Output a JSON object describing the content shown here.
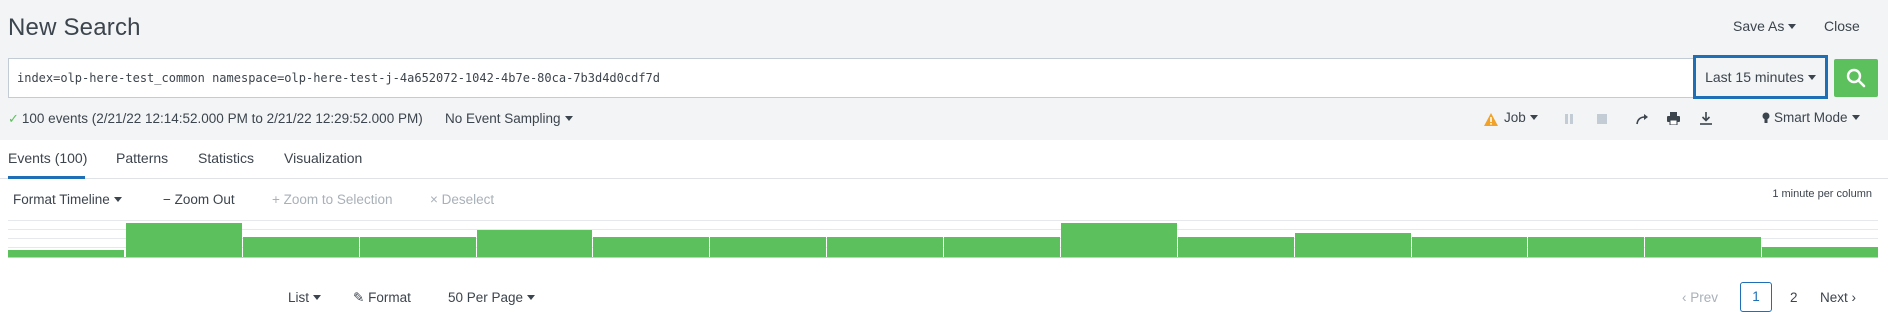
{
  "header": {
    "title": "New Search",
    "save_as_label": "Save As",
    "close_label": "Close"
  },
  "search": {
    "query": "index=olp-here-test_common namespace=olp-here-test-j-4a652072-1042-4b7e-80ca-7b3d4d0cdf7d",
    "time_range_label": "Last 15 minutes"
  },
  "status": {
    "events_summary": "100 events (2/21/22 12:14:52.000 PM to 2/21/22 12:29:52.000 PM)",
    "sampling_label": "No Event Sampling"
  },
  "job": {
    "job_label": "Job",
    "mode_label": "Smart Mode"
  },
  "tabs": [
    {
      "label": "Events (100)",
      "active": true
    },
    {
      "label": "Patterns",
      "active": false
    },
    {
      "label": "Statistics",
      "active": false
    },
    {
      "label": "Visualization",
      "active": false
    }
  ],
  "timeline": {
    "format_label": "Format Timeline",
    "zoom_out_label": "Zoom Out",
    "zoom_selection_label": "Zoom to Selection",
    "deselect_label": "Deselect",
    "scale_label": "1 minute per column",
    "counts": [
      2,
      10,
      6,
      6,
      8,
      6,
      6,
      6,
      6,
      10,
      6,
      7,
      6,
      6,
      6,
      3
    ]
  },
  "results_controls": {
    "list_label": "List",
    "format_label": "Format",
    "per_page_label": "50 Per Page"
  },
  "pagination": {
    "prev_label": "Prev",
    "current_page": "1",
    "page_2": "2",
    "next_label": "Next"
  },
  "colors": {
    "accent": "#1e6fb5",
    "bar": "#5cc05c",
    "warning": "#f1a22b"
  }
}
